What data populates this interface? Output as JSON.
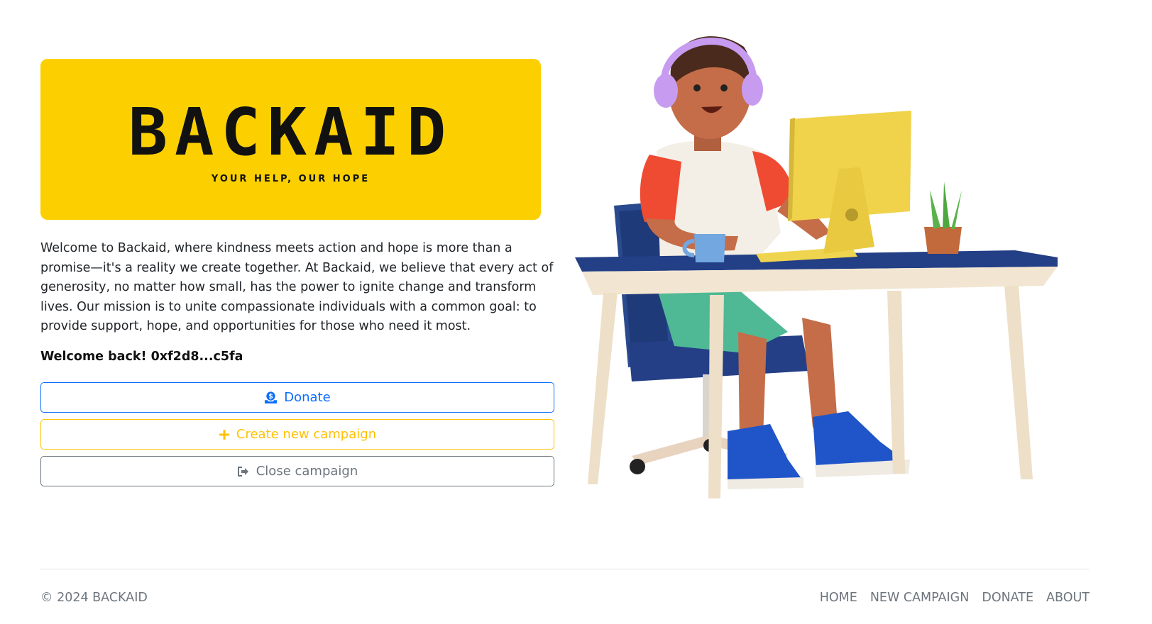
{
  "logo": {
    "wordmark": "BACKAID",
    "tagline": "YOUR HELP, OUR HOPE",
    "background_color": "#fcd000"
  },
  "intro_text": "Welcome to Backaid, where kindness meets action and hope is more than a promise—it's a reality we create together. At Backaid, we believe that every act of generosity, no matter how small, has the power to ignite change and transform lives. Our mission is to unite compassionate individuals with a common goal: to provide support, hope, and opportunities for those who need it most.",
  "welcome": {
    "label": "Welcome back!",
    "address": "0xf2d8...c5fa"
  },
  "buttons": {
    "donate": {
      "label": "Donate",
      "icon": "donate-coin-icon",
      "color": "#0d6efd"
    },
    "create": {
      "label": "Create new campaign",
      "icon": "plus-icon",
      "color": "#ffc107"
    },
    "close": {
      "label": "Close campaign",
      "icon": "sign-out-icon",
      "color": "#6c757d"
    }
  },
  "illustration": {
    "icon": "person-at-desk-illustration"
  },
  "footer": {
    "copyright": "© 2024 BACKAID",
    "nav": [
      "HOME",
      "NEW CAMPAIGN",
      "DONATE",
      "ABOUT"
    ]
  }
}
